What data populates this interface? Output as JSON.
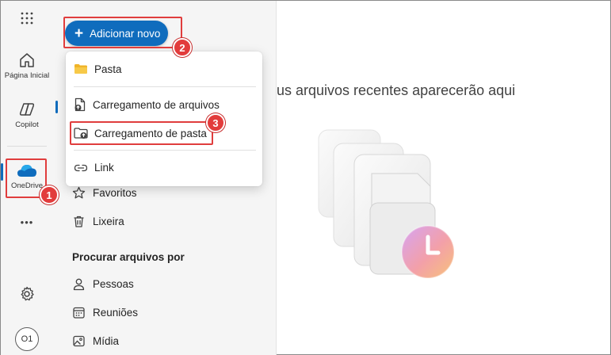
{
  "rail": {
    "home_label": "Página Inicial",
    "copilot_label": "Copilot",
    "onedrive_label": "OneDrive",
    "more_label": "•••",
    "avatar_initials": "O1"
  },
  "nav": {
    "add_new_label": "Adicionar novo",
    "favorites_label": "Favoritos",
    "trash_label": "Lixeira",
    "browse_section": "Procurar arquivos por",
    "people_label": "Pessoas",
    "meetings_label": "Reuniões",
    "media_label": "Mídia"
  },
  "menu": {
    "folder_label": "Pasta",
    "file_upload_label": "Carregamento de arquivos",
    "folder_upload_label": "Carregamento de pasta",
    "link_label": "Link"
  },
  "main": {
    "empty_text": "us arquivos recentes aparecerão aqui"
  },
  "callouts": {
    "step1": "1",
    "step2": "2",
    "step3": "3"
  },
  "colors": {
    "accent": "#0f6cbd",
    "callout": "#e03d3d",
    "folder": "#f0b429"
  }
}
